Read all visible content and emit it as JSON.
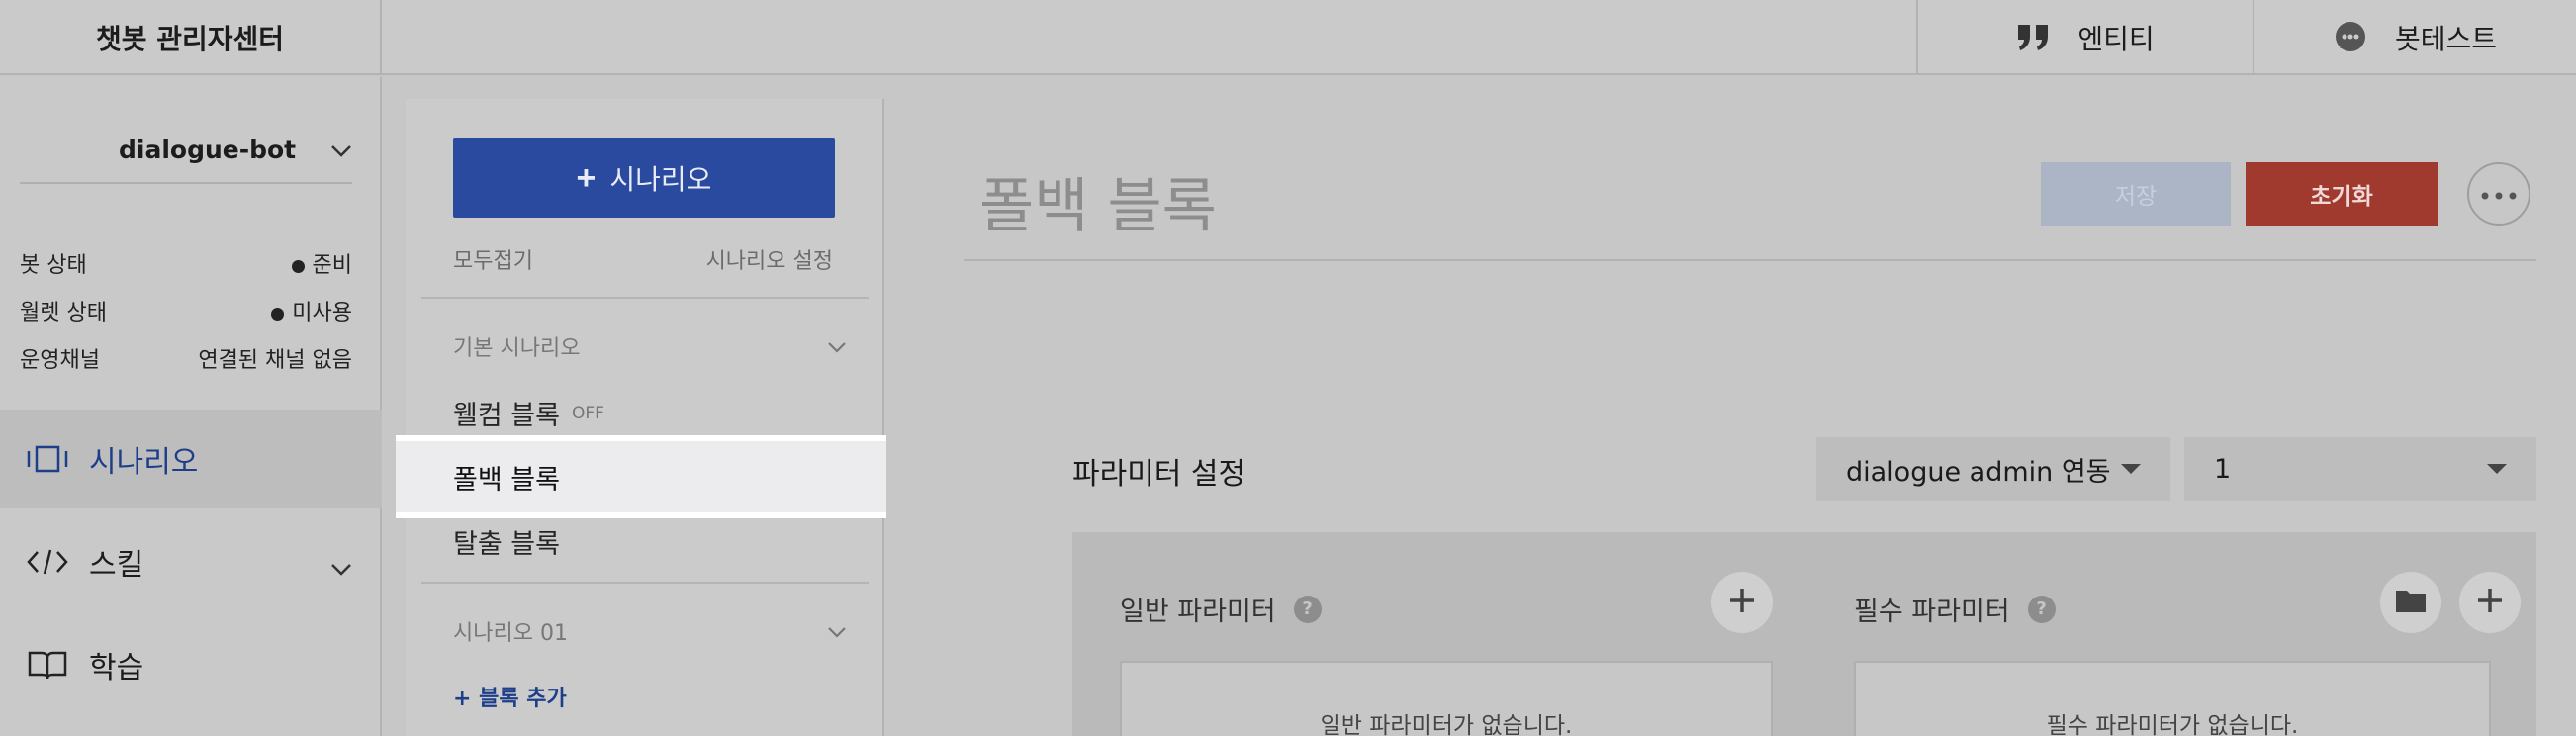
{
  "app": {
    "title": "챗봇 관리자센터"
  },
  "topbar": {
    "entity_label": "엔티티",
    "bottest_label": "봇테스트"
  },
  "sidebar": {
    "bot_name": "dialogue-bot",
    "status": [
      {
        "label": "봇 상태",
        "value": "준비",
        "dot": true
      },
      {
        "label": "월렛 상태",
        "value": "미사용",
        "dot": true
      },
      {
        "label": "운영채널",
        "value": "연결된 채널 없음",
        "dot": false
      }
    ],
    "nav": [
      {
        "label": "시나리오",
        "icon": "scenario-icon",
        "active": true
      },
      {
        "label": "스킬",
        "icon": "code-icon",
        "active": false
      },
      {
        "label": "학습",
        "icon": "book-icon",
        "active": false
      }
    ]
  },
  "scenario_panel": {
    "add_button": "시나리오",
    "collapse_all": "모두접기",
    "scenario_settings": "시나리오 설정",
    "group_default": "기본 시나리오",
    "blocks": [
      {
        "label": "웰컴 블록",
        "tag": "OFF"
      },
      {
        "label": "폴백 블록",
        "selected": true
      },
      {
        "label": "탈출 블록"
      }
    ],
    "group_2": "시나리오 01",
    "add_block": "+ 블록 추가"
  },
  "main": {
    "title": "폴백 블록",
    "save_label": "저장",
    "reset_label": "초기화",
    "param_title": "파라미터 설정",
    "admin_select": "dialogue admin 연동",
    "number_select": "1",
    "general_params": "일반 파라미터",
    "required_params": "필수 파라미터",
    "general_empty": "일반 파라미터가 없습니다.",
    "required_empty": "필수 파라미터가 없습니다."
  },
  "colors": {
    "primary": "#2a4aa0",
    "danger": "#a0392e",
    "link": "#1d3f8a"
  }
}
